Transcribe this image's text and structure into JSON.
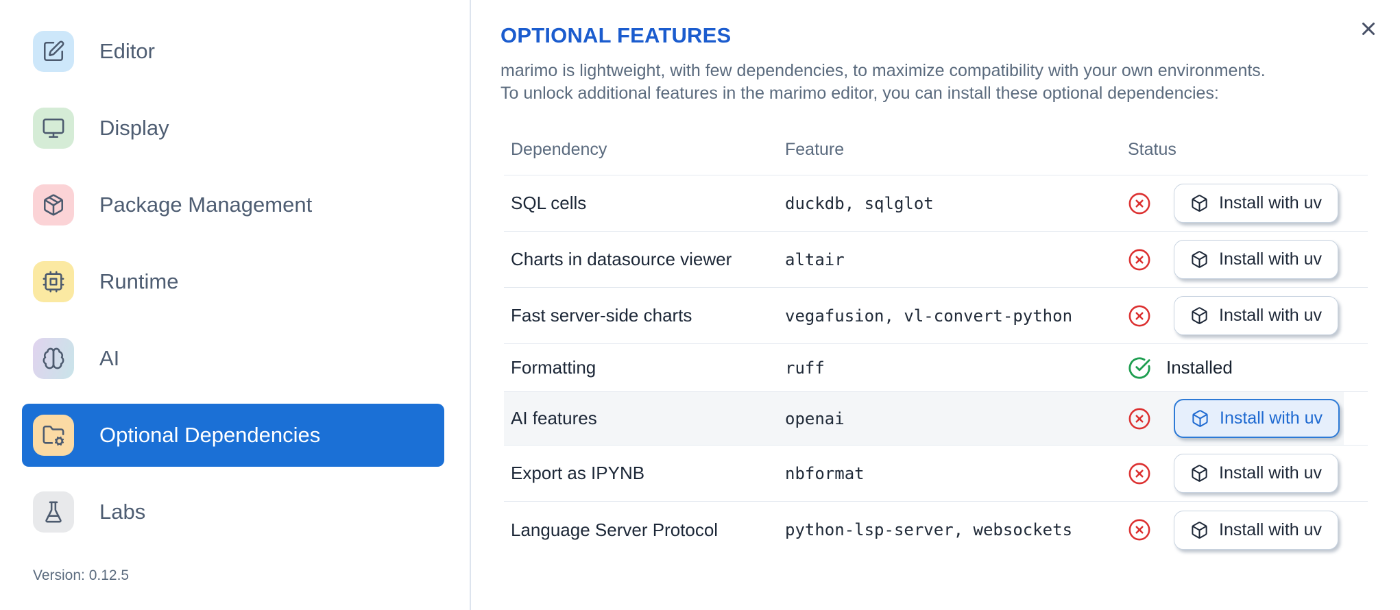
{
  "sidebar": {
    "items": [
      {
        "label": "Editor",
        "icon": "square-pen",
        "icon_bg": "#cde7fa",
        "selected": false
      },
      {
        "label": "Display",
        "icon": "monitor",
        "icon_bg": "#d5ecd6",
        "selected": false
      },
      {
        "label": "Package Management",
        "icon": "package",
        "icon_bg": "#fbd3d6",
        "selected": false
      },
      {
        "label": "Runtime",
        "icon": "cpu",
        "icon_bg": "#fbe9a2",
        "selected": false
      },
      {
        "label": "AI",
        "icon": "brain",
        "icon_bg": "linear-gradient(105deg, #e0d3ee, #c9e4e9)",
        "selected": false
      },
      {
        "label": "Optional Dependencies",
        "icon": "folder-cog",
        "icon_bg": "#fbdaa4",
        "selected": true
      },
      {
        "label": "Labs",
        "icon": "flask",
        "icon_bg": "#e8e9eb",
        "selected": false
      }
    ],
    "version": "Version: 0.12.5"
  },
  "panel": {
    "title": "OPTIONAL FEATURES",
    "description_lines": [
      "marimo is lightweight, with few dependencies, to maximize compatibility with your own environments.",
      "To unlock additional features in the marimo editor, you can install these optional dependencies:"
    ],
    "close_icon": "x"
  },
  "table": {
    "columns": [
      "Dependency",
      "Feature",
      "Status"
    ],
    "install_button_label": "Install with uv",
    "installed_label": "Installed",
    "rows": [
      {
        "dependency": "SQL cells",
        "feature": "duckdb, sqlglot",
        "status": "missing",
        "highlighted": false
      },
      {
        "dependency": "Charts in datasource viewer",
        "feature": "altair",
        "status": "missing",
        "highlighted": false
      },
      {
        "dependency": "Fast server-side charts",
        "feature": "vegafusion, vl-convert-python",
        "status": "missing",
        "highlighted": false
      },
      {
        "dependency": "Formatting",
        "feature": "ruff",
        "status": "installed",
        "highlighted": false
      },
      {
        "dependency": "AI features",
        "feature": "openai",
        "status": "missing",
        "highlighted": true
      },
      {
        "dependency": "Export as IPYNB",
        "feature": "nbformat",
        "status": "missing",
        "highlighted": false
      },
      {
        "dependency": "Language Server Protocol",
        "feature": "python-lsp-server, websockets",
        "status": "missing",
        "highlighted": false
      }
    ]
  },
  "colors": {
    "accent_blue": "#1b70d6",
    "title_blue": "#1b5cce",
    "status_red": "#dc3030",
    "status_green": "#1e9e50"
  }
}
